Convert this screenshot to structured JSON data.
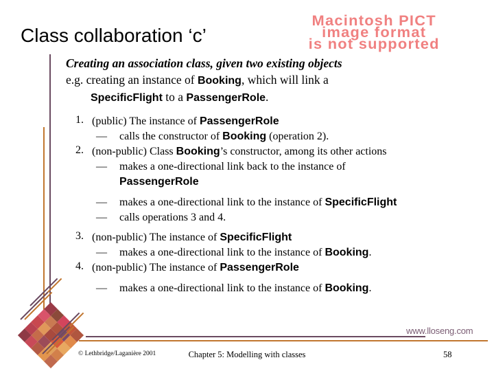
{
  "slide": {
    "title": "Class collaboration ‘c’",
    "pict_placeholder": {
      "line1": "Macintosh PICT",
      "line2": "image format",
      "line3": "is not supported",
      "color": "#f08080"
    },
    "lead": "Creating an association class, given two existing objects",
    "example": {
      "part1": "e.g. creating an instance of ",
      "id1": "Booking",
      "part2": ", which will link a",
      "id2": "SpecificFlight",
      "part3": " to a ",
      "id3": "PassengerRole",
      "part4": "."
    },
    "steps": [
      {
        "num": "1.",
        "text_pre": "(public) The instance of ",
        "id": "PassengerRole",
        "text_post": "",
        "subs": [
          {
            "dash": "—",
            "pre": "calls the constructor of ",
            "id": "Booking",
            "post": " (operation 2)."
          }
        ]
      },
      {
        "num": "2.",
        "text_pre": "(non-public) Class ",
        "id": "Booking",
        "text_post": "’s constructor, among its other actions",
        "subs": [
          {
            "dash": "—",
            "pre": "makes a one-directional link back to the instance of",
            "id": "PassengerRole",
            "post": ""
          },
          {
            "dash": "—",
            "pre": "makes a one-directional link to the instance of ",
            "id": "SpecificFlight",
            "post": ""
          },
          {
            "dash": "—",
            "pre": "calls operations 3 and 4.",
            "id": "",
            "post": ""
          }
        ]
      },
      {
        "num": "3.",
        "text_pre": "(non-public) The instance of ",
        "id": "SpecificFlight",
        "text_post": "",
        "subs": [
          {
            "dash": "—",
            "pre": "makes a one-directional link to the instance of ",
            "id": "Booking",
            "post": "."
          }
        ]
      },
      {
        "num": "4.",
        "text_pre": "(non-public) The instance of ",
        "id": "PassengerRole",
        "text_post": "",
        "subs": [
          {
            "dash": "—",
            "pre": "makes a one-directional link to the instance of ",
            "id": "Booking",
            "post": "."
          }
        ]
      }
    ]
  },
  "footer": {
    "watermark_url": "www.lloseng.com",
    "copyright": "© Lethbridge/Laganière 2001",
    "chapter": "Chapter 5: Modelling with classes",
    "page_number": "58"
  },
  "decor": {
    "purple": "#6a4a60",
    "orange": "#c1762f",
    "logo_colors": [
      "#9a3b47",
      "#8b4a3a",
      "#d2455c",
      "#c2553a",
      "#b0563f",
      "#d9536a",
      "#c97a52",
      "#b0533d",
      "#7a4a6a",
      "#e08a4a",
      "#c8484f",
      "#e0985a",
      "#a84a3e",
      "#d95a3a",
      "#e8a860",
      "#b84250",
      "#c56b4a",
      "#9c4b58",
      "#e0a05a",
      "#d2804a",
      "#8e3a45",
      "#c84a58",
      "#b35a45",
      "#e2954e",
      "#c06a4e"
    ]
  }
}
